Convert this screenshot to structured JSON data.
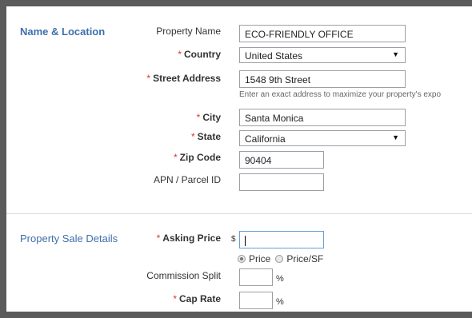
{
  "sections": {
    "name_location": "Name & Location",
    "sale_details": "Property Sale Details"
  },
  "fields": {
    "property_name": {
      "label": "Property Name",
      "value": "ECO-FRIENDLY OFFICE"
    },
    "country": {
      "label": "Country",
      "value": "United States"
    },
    "street_address": {
      "label": "Street Address",
      "value": "1548 9th Street",
      "hint": "Enter an exact address to maximize your property's expo"
    },
    "city": {
      "label": "City",
      "value": "Santa Monica"
    },
    "state": {
      "label": "State",
      "value": "California"
    },
    "zip": {
      "label": "Zip Code",
      "value": "90404"
    },
    "apn": {
      "label": "APN / Parcel ID",
      "value": ""
    },
    "asking_price": {
      "label": "Asking Price",
      "value": "",
      "currency": "$"
    },
    "price_type": {
      "options": [
        "Price",
        "Price/SF"
      ],
      "selected": "Price"
    },
    "commission_split": {
      "label": "Commission Split",
      "value": "",
      "unit": "%"
    },
    "cap_rate": {
      "label": "Cap Rate",
      "value": "",
      "unit": "%"
    }
  },
  "required_marker": "*"
}
